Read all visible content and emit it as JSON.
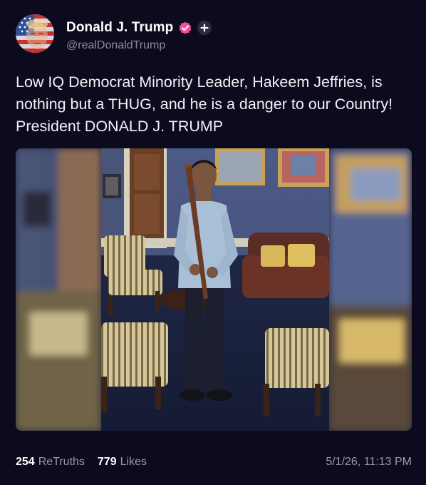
{
  "post": {
    "author": {
      "display_name": "Donald J. Trump",
      "handle": "@realDonaldTrump",
      "verified_icon": "verified-badge-icon",
      "follow_icon": "plus-icon",
      "avatar_icon": "flag-face-avatar"
    },
    "text": "Low IQ Democrat Minority Leader, Hakeem Jeffries, is nothing but a THUG, and he is a danger to our Country! President DONALD J. TRUMP",
    "image": {
      "subject": "man-holding-baseball-bat-in-office"
    },
    "stats": {
      "retruths_count": "254",
      "retruths_label": "ReTruths",
      "likes_count": "779",
      "likes_label": "Likes"
    },
    "timestamp": "5/1/26, 11:13 PM"
  },
  "colors": {
    "background": "#0c0a1d",
    "verified_badge": "#f34ea0",
    "text_primary": "#f2f1f7",
    "text_secondary": "#9c99b1"
  }
}
